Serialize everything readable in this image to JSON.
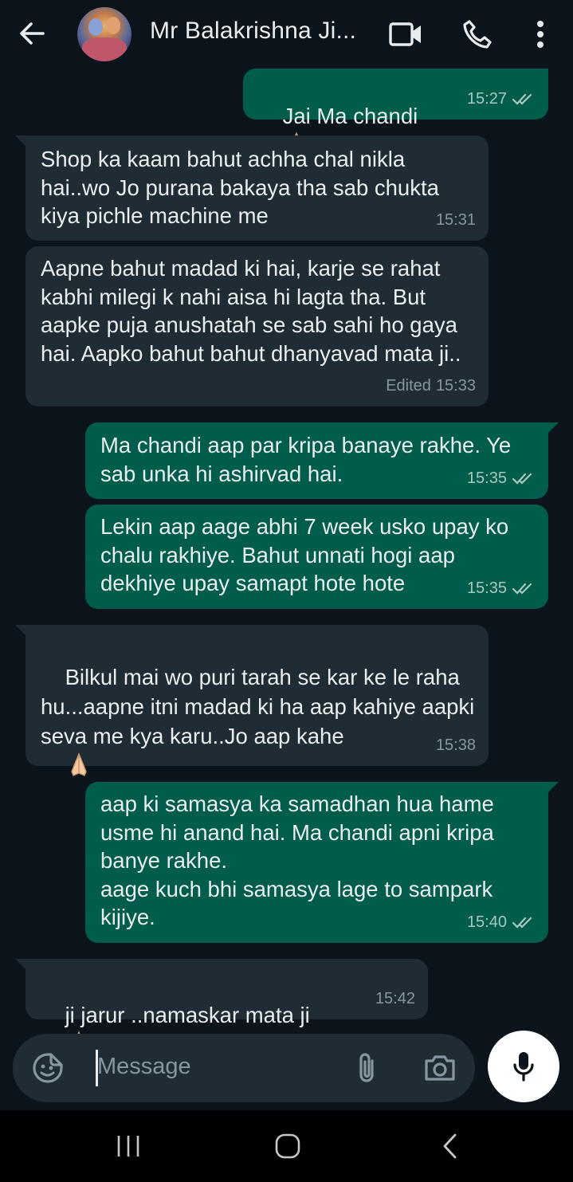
{
  "header": {
    "title": "Mr Balakrishna Ji...",
    "back_icon": "arrow-left-icon",
    "video_icon": "video-call-icon",
    "call_icon": "phone-icon",
    "menu_icon": "more-vert-icon"
  },
  "messages": [
    {
      "dir": "out",
      "text": "Jai Ma chandi",
      "emoji": "folded-hands",
      "time": "15:27",
      "status": "read"
    },
    {
      "dir": "in",
      "text": "Shop ka kaam bahut achha chal nikla hai..wo Jo purana bakaya tha sab chukta kiya pichle machine me",
      "time": "15:31"
    },
    {
      "dir": "in",
      "text": "Aapne bahut madad ki hai, karje se rahat kabhi milegi k nahi aisa hi lagta tha. But aapke puja anushatah se sab sahi ho gaya hai. Aapko bahut bahut dhanyavad mata ji..",
      "edited": "Edited",
      "time": "15:33"
    },
    {
      "dir": "out",
      "text": "Ma chandi aap par kripa banaye rakhe. Ye sab unka hi ashirvad hai.",
      "time": "15:35",
      "status": "read"
    },
    {
      "dir": "out",
      "text": "Lekin aap aage abhi 7 week usko upay ko chalu rakhiye. Bahut unnati hogi aap dekhiye upay samapt hote hote",
      "time": "15:35",
      "status": "read"
    },
    {
      "dir": "in",
      "text": "Bilkul mai wo puri tarah se kar ke le raha hu...aapne itni madad ki ha aap kahiye aapki seva me kya karu..Jo aap kahe",
      "emoji": "folded-hands",
      "time": "15:38"
    },
    {
      "dir": "out",
      "text": "aap ki samasya ka samadhan hua hame usme hi anand hai. Ma chandi apni kripa banye rakhe.\naage kuch bhi samasya lage to sampark kijiye.",
      "time": "15:40",
      "status": "read"
    },
    {
      "dir": "in",
      "text": "ji jarur ..namaskar mata ji",
      "emoji": "folded-hands",
      "time": "15:42"
    }
  ],
  "composer": {
    "placeholder": "Message",
    "emoji_icon": "sticker-smiley-icon",
    "attach_icon": "paperclip-icon",
    "camera_icon": "camera-icon",
    "mic_icon": "microphone-icon"
  },
  "colors": {
    "background": "#0b141a",
    "incoming_bubble": "#202c33",
    "outgoing_bubble": "#005c4b",
    "text": "#e9edef",
    "meta": "#8696a0"
  }
}
